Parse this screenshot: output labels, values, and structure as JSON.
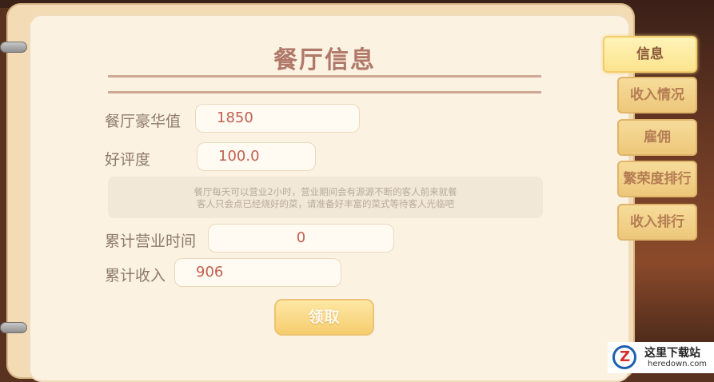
{
  "page": {
    "title": "餐厅信息"
  },
  "fields": {
    "luxury": {
      "label": "餐厅豪华值",
      "value": "1850"
    },
    "rating": {
      "label": "好评度",
      "value": "100.0"
    },
    "hours": {
      "label": "累计营业时间",
      "value": "0"
    },
    "income": {
      "label": "累计收入",
      "value": "906"
    }
  },
  "description": {
    "line1": "餐厅每天可以营业2小时，营业期间会有源源不断的客人前来就餐",
    "line2": "客人只会点已经烧好的菜，请准备好丰富的菜式等待客人光临吧"
  },
  "claim_button": "领取",
  "tabs": [
    {
      "label": "信息",
      "active": true
    },
    {
      "label": "收入情况",
      "active": false
    },
    {
      "label": "雇佣",
      "active": false
    },
    {
      "label": "繁荣度排行",
      "active": false
    },
    {
      "label": "收入排行",
      "active": false
    }
  ],
  "watermark": {
    "logo": "Z",
    "title": "这里下载站",
    "url": "heredown.com"
  }
}
